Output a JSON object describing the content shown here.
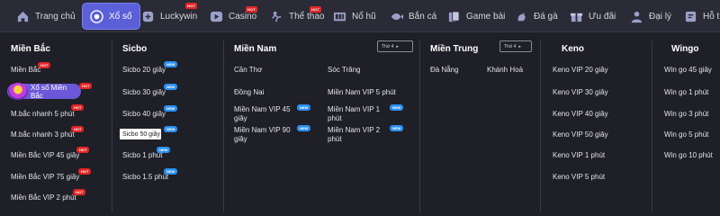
{
  "nav": {
    "home": "Trang chủ",
    "xoso": "Xổ số",
    "luckywin": "Luckywin",
    "casino": "Casino",
    "thethao": "Thể thao",
    "nohu": "Nổ hũ",
    "banca": "Bắn cá",
    "gamebai": "Game bài",
    "daga": "Đá gà",
    "uudai": "Ưu đãi",
    "daily": "Đại lý",
    "hotro": "Hỗ trợ"
  },
  "tags": {
    "hot": "HOT",
    "new": "NEW"
  },
  "mienbac": {
    "title": "Miền Bắc",
    "items": [
      "Miền Bắc",
      "Xổ số Miền Bắc",
      "M.bắc nhanh 5 phút",
      "M.bắc nhanh 3 phút",
      "Miền Bắc VIP 45 giây",
      "Miền Bắc VIP 75 giây",
      "Miền Bắc VIP 2 phút"
    ]
  },
  "sicbo": {
    "title": "Sicbo",
    "items": [
      "Sicbo 20 giây",
      "Sicbo 30 giây",
      "Sicbo 40 giây",
      "Sicbo 50 giây",
      "Sicbo 1 phút",
      "Sicbo 1.5 phút"
    ]
  },
  "miennam": {
    "title": "Miền Nam",
    "day": "Thứ 4",
    "left": [
      "Cần Thơ",
      "Đồng Nai",
      "Miền Nam VIP 45 giây",
      "Miền Nam VIP 90 giây"
    ],
    "right": [
      "Sóc Trăng",
      "Miền Nam VIP 5 phút",
      "Miền Nam VIP 1 phút",
      "Miền Nam VIP 2 phút"
    ]
  },
  "mientrung": {
    "title": "Miền Trung",
    "day": "Thứ 4",
    "items": [
      "Đà Nẵng",
      "Khánh Hoà"
    ]
  },
  "keno": {
    "title": "Keno",
    "items": [
      "Keno VIP 20 giây",
      "Keno VIP 30 giây",
      "Keno VIP 40 giây",
      "Keno VIP 50 giây",
      "Keno VIP 1 phút",
      "Keno VIP 5 phút"
    ]
  },
  "wingo": {
    "title": "Wingo",
    "items": [
      "Win go 45 giây",
      "Win go 1 phút",
      "Win go 3 phút",
      "Win go 5 phút",
      "Win go 10 phút"
    ]
  },
  "tooltip": "Sicbo 50 giây",
  "colors": {
    "accent": "#5b5fd8",
    "hot": "#e52424",
    "new": "#2b8ef1",
    "bg": "#1f1f27",
    "nav_bg": "#2a2b36"
  }
}
